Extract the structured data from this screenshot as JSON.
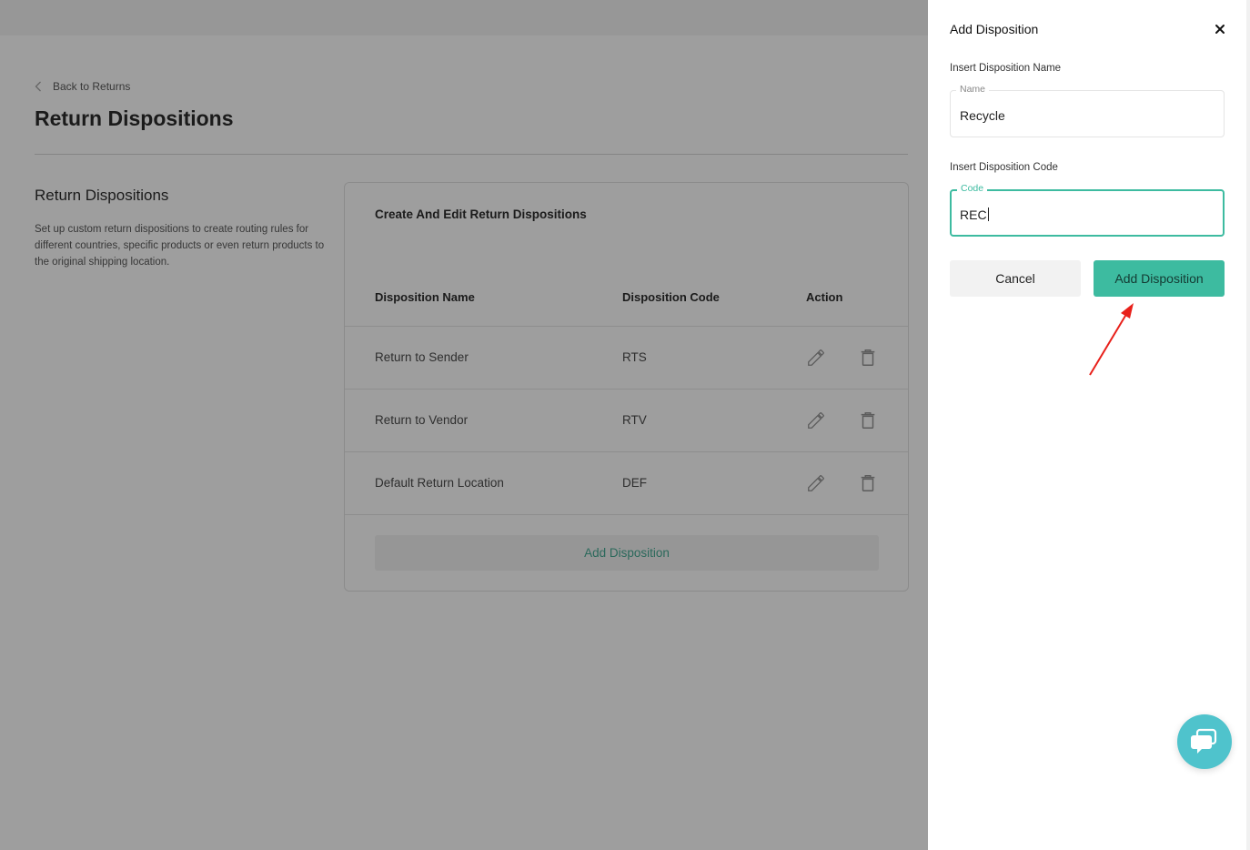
{
  "back_link": "Back to Returns",
  "page_title": "Return Dispositions",
  "section": {
    "title": "Return Dispositions",
    "description": "Set up custom return dispositions to create routing rules for different countries, specific products or even return products to the original shipping location."
  },
  "card": {
    "title": "Create And Edit Return Dispositions",
    "columns": [
      "Disposition Name",
      "Disposition Code",
      "Action"
    ],
    "rows": [
      {
        "name": "Return to Sender",
        "code": "RTS"
      },
      {
        "name": "Return to Vendor",
        "code": "RTV"
      },
      {
        "name": "Default Return Location",
        "code": "DEF"
      }
    ],
    "add_button": "Add Disposition",
    "row_icons": [
      "pencil-icon",
      "trash-icon"
    ]
  },
  "panel": {
    "title": "Add Disposition",
    "name_label": "Insert Disposition Name",
    "name_legend": "Name",
    "name_value": "Recycle",
    "code_label": "Insert Disposition Code",
    "code_legend": "Code",
    "code_value": "REC",
    "cancel_label": "Cancel",
    "add_label": "Add Disposition"
  },
  "colors": {
    "accent": "#3dbba0",
    "chat": "#4fc3cc",
    "arrow": "#e8201a"
  }
}
